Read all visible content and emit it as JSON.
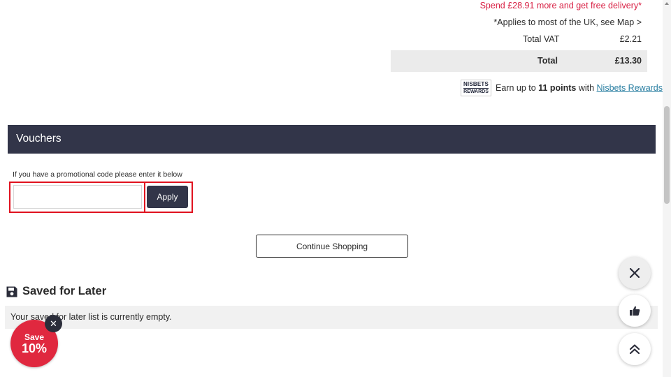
{
  "summary": {
    "free_delivery": "Spend £28.91 more and get free delivery*",
    "applies": "*Applies to most of the UK, see Map >",
    "vat_label": "Total VAT",
    "vat_value": "£2.21",
    "total_label": "Total",
    "total_value": "£13.30"
  },
  "rewards": {
    "logo_line1": "NISBETS",
    "logo_line2": "REWARDS",
    "earn_prefix": "Earn up to ",
    "points": "11 points",
    "earn_middle": " with ",
    "link": "Nisbets Rewards"
  },
  "vouchers": {
    "title": "Vouchers",
    "hint": "If you have a promotional code please enter it below",
    "input_value": "",
    "apply_label": "Apply"
  },
  "continue_label": "Continue Shopping",
  "saved": {
    "title": "Saved for Later",
    "empty_text": "Your saved for later list is currently empty."
  },
  "save_badge": {
    "line1": "Save",
    "line2": "10%",
    "close": "✕"
  },
  "icons": {
    "saved": "floppy-disk-icon",
    "close": "close-icon",
    "like": "thumbs-up-icon",
    "top": "double-chevron-up-icon"
  },
  "colors": {
    "accent_red": "#d81f43",
    "navy": "#323549",
    "link": "#2a7fa2",
    "badge_red": "#e0283f"
  }
}
